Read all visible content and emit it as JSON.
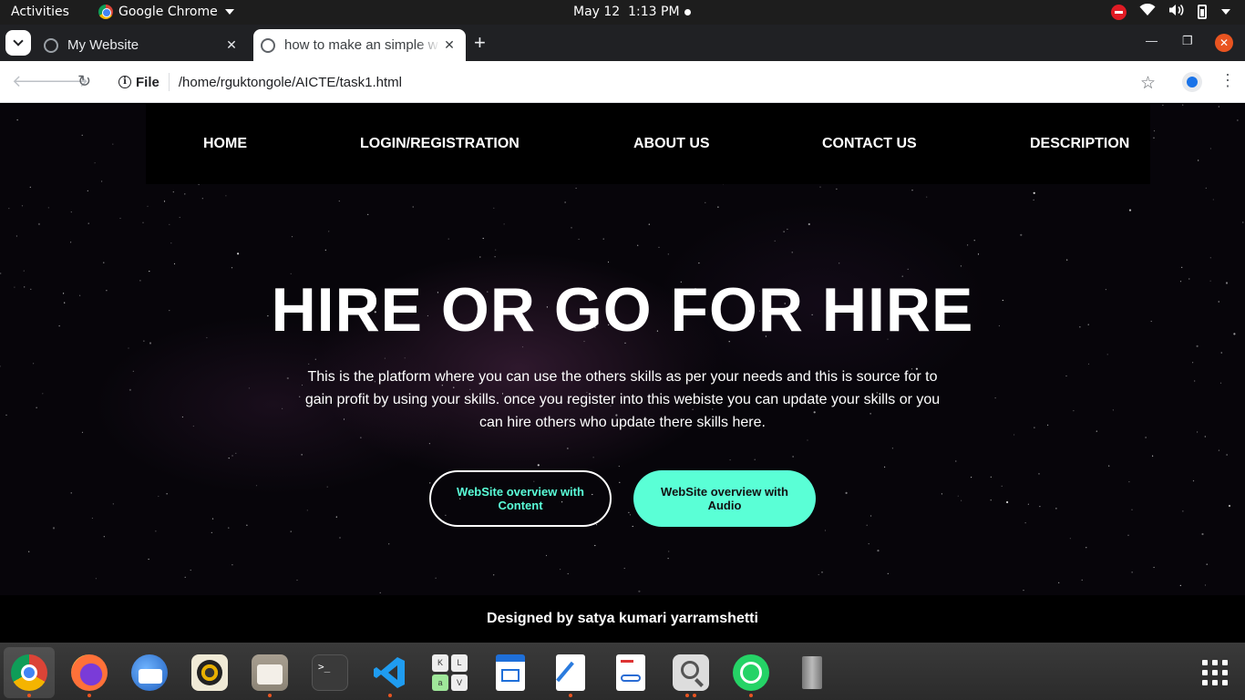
{
  "system_bar": {
    "activities": "Activities",
    "app_name": "Google Chrome",
    "date": "May 12",
    "time": "1:13 PM"
  },
  "browser": {
    "tabs": [
      {
        "title": "My Website",
        "active": false
      },
      {
        "title": "how to make an simple w",
        "active": true
      }
    ],
    "url_scheme": "File",
    "url": "/home/rguktongole/AICTE/task1.html"
  },
  "site": {
    "nav": [
      "HOME",
      "LOGIN/REGISTRATION",
      "ABOUT US",
      "CONTACT US",
      "DESCRIPTION"
    ],
    "hero_title": "HIRE OR GO FOR HIRE",
    "hero_text": "This is the platform where you can use the others skills as per your needs and this is source for to gain profit by using your skills. once you register into this webiste you can update your skills or you can hire others who update there skills here.",
    "button_content": "WebSite overview with Content",
    "button_audio": "WebSite overview with Audio",
    "footer": "Designed by satya kumari yarramshetti"
  },
  "colors": {
    "accent": "#5affd6",
    "ubuntu_orange": "#e95420"
  },
  "dock_apps": [
    "chrome-icon",
    "firefox-icon",
    "thunderbird-icon",
    "rhythmbox-icon",
    "files-icon",
    "terminal-icon",
    "vscode-icon",
    "keyboard-icon",
    "libreoffice-impress-icon",
    "text-editor-icon",
    "document-viewer-icon",
    "image-viewer-icon",
    "whatsapp-icon",
    "trash-icon",
    "show-apps-icon"
  ]
}
